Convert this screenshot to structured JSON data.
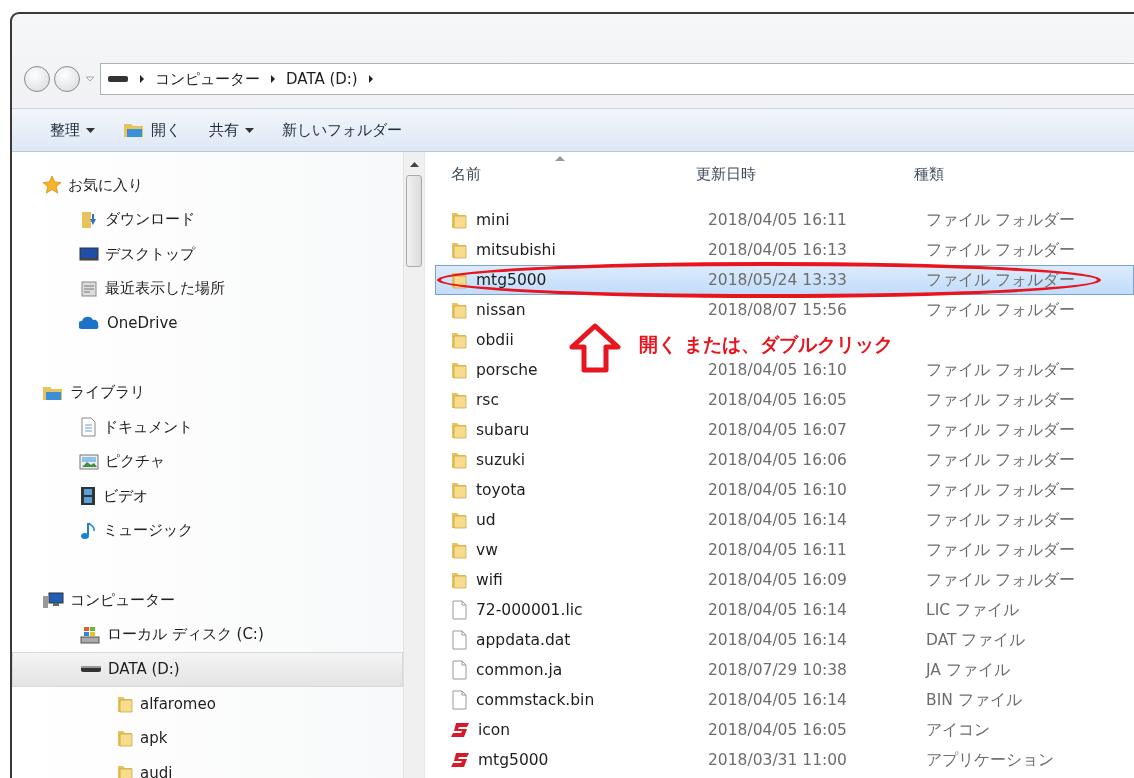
{
  "address": {
    "crumbs": [
      "コンピューター",
      "DATA (D:)"
    ]
  },
  "toolbar": [
    {
      "label": "整理",
      "dropdown": true,
      "kind": "plain"
    },
    {
      "label": "開く",
      "dropdown": false,
      "kind": "open"
    },
    {
      "label": "共有",
      "dropdown": true,
      "kind": "plain"
    },
    {
      "label": "新しいフォルダー",
      "dropdown": false,
      "kind": "plain"
    }
  ],
  "sidebar": {
    "groups": [
      {
        "label": "お気に入り",
        "kind": "star",
        "children": [
          {
            "label": "ダウンロード",
            "kind": "download",
            "selected": false
          },
          {
            "label": "デスクトップ",
            "kind": "desktop",
            "selected": false
          },
          {
            "label": "最近表示した場所",
            "kind": "recent",
            "selected": false
          },
          {
            "label": "OneDrive",
            "kind": "cloud",
            "selected": false
          }
        ]
      },
      {
        "label": "ライブラリ",
        "kind": "library",
        "children": [
          {
            "label": "ドキュメント",
            "kind": "document",
            "selected": false
          },
          {
            "label": "ピクチャ",
            "kind": "picture",
            "selected": false
          },
          {
            "label": "ビデオ",
            "kind": "video",
            "selected": false
          },
          {
            "label": "ミュージック",
            "kind": "music",
            "selected": false
          }
        ]
      },
      {
        "label": "コンピューター",
        "kind": "computer",
        "children": [
          {
            "label": "ローカル ディスク (C:)",
            "kind": "system-drive",
            "selected": false
          },
          {
            "label": "DATA (D:)",
            "kind": "drive",
            "selected": true,
            "children": [
              {
                "label": "alfaromeo",
                "kind": "folder",
                "selected": false
              },
              {
                "label": "apk",
                "kind": "folder",
                "selected": false
              },
              {
                "label": "audi",
                "kind": "folder",
                "selected": false
              }
            ]
          }
        ]
      }
    ]
  },
  "table": {
    "columns": [
      "名前",
      "更新日時",
      "種類"
    ],
    "rows": [
      {
        "name": "mini",
        "date": "2018/04/05 16:11",
        "type": "ファイル フォルダー",
        "kind": "folder",
        "selected": false
      },
      {
        "name": "mitsubishi",
        "date": "2018/04/05 16:13",
        "type": "ファイル フォルダー",
        "kind": "folder",
        "selected": false
      },
      {
        "name": "mtg5000",
        "date": "2018/05/24 13:33",
        "type": "ファイル フォルダー",
        "kind": "folder",
        "selected": true
      },
      {
        "name": "nissan",
        "date": "2018/08/07 15:56",
        "type": "ファイル フォルダー",
        "kind": "folder",
        "selected": false
      },
      {
        "name": "obdii",
        "kind": "folder",
        "selected": false
      },
      {
        "name": "porsche",
        "date": "2018/04/05 16:10",
        "type": "ファイル フォルダー",
        "kind": "folder",
        "selected": false
      },
      {
        "name": "rsc",
        "date": "2018/04/05 16:05",
        "type": "ファイル フォルダー",
        "kind": "folder",
        "selected": false
      },
      {
        "name": "subaru",
        "date": "2018/04/05 16:07",
        "type": "ファイル フォルダー",
        "kind": "folder",
        "selected": false
      },
      {
        "name": "suzuki",
        "date": "2018/04/05 16:06",
        "type": "ファイル フォルダー",
        "kind": "folder",
        "selected": false
      },
      {
        "name": "toyota",
        "date": "2018/04/05 16:10",
        "type": "ファイル フォルダー",
        "kind": "folder",
        "selected": false
      },
      {
        "name": "ud",
        "date": "2018/04/05 16:14",
        "type": "ファイル フォルダー",
        "kind": "folder",
        "selected": false
      },
      {
        "name": "vw",
        "date": "2018/04/05 16:11",
        "type": "ファイル フォルダー",
        "kind": "folder",
        "selected": false
      },
      {
        "name": "wifi",
        "date": "2018/04/05 16:09",
        "type": "ファイル フォルダー",
        "kind": "folder",
        "selected": false
      },
      {
        "name": "72-000001.lic",
        "date": "2018/04/05 16:14",
        "type": "LIC ファイル",
        "kind": "file",
        "selected": false
      },
      {
        "name": "appdata.dat",
        "date": "2018/04/05 16:14",
        "type": "DAT ファイル",
        "kind": "file",
        "selected": false
      },
      {
        "name": "common.ja",
        "date": "2018/07/29 10:38",
        "type": "JA ファイル",
        "kind": "file",
        "selected": false
      },
      {
        "name": "commstack.bin",
        "date": "2018/04/05 16:14",
        "type": "BIN ファイル",
        "kind": "file",
        "selected": false
      },
      {
        "name": "icon",
        "date": "2018/04/05 16:05",
        "type": "アイコン",
        "kind": "app",
        "selected": false
      },
      {
        "name": "mtg5000",
        "date": "2018/03/31 11:00",
        "type": "アプリケーション",
        "kind": "app",
        "selected": false
      }
    ]
  },
  "annotation": {
    "text": "開く または、ダブルクリック"
  }
}
